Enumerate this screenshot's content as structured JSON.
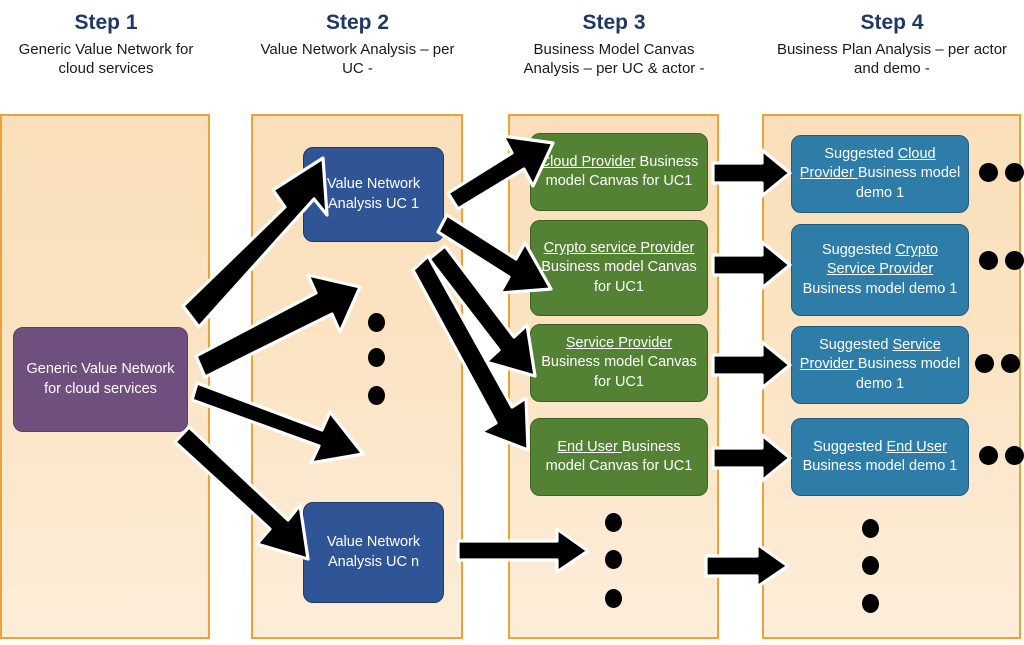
{
  "columns": [
    {
      "id": "step1",
      "title": "Step 1",
      "subtitle": "Generic Value Network for cloud services"
    },
    {
      "id": "step2",
      "title": "Step 2",
      "subtitle": "Value Network Analysis – per UC -"
    },
    {
      "id": "step3",
      "title": "Step 3",
      "subtitle": "Business Model Canvas Analysis – per UC & actor -"
    },
    {
      "id": "step4",
      "title": "Step 4",
      "subtitle": "Business Plan Analysis – per actor and demo -"
    }
  ],
  "step1": {
    "node": {
      "label": "Generic Value Network for cloud services"
    }
  },
  "step2": {
    "nodes": [
      {
        "label": "Value Network Analysis UC 1"
      },
      {
        "label": "Value Network Analysis UC n"
      }
    ],
    "ellipsis": "⋮"
  },
  "step3": {
    "nodes": [
      {
        "actor": "Cloud Provider",
        "rest": " Business model Canvas for UC1"
      },
      {
        "actor": "Crypto service Provider ",
        "rest": "Business model Canvas for UC1"
      },
      {
        "actor": "Service Provider",
        "rest": " Business model Canvas for UC1"
      },
      {
        "actor": "End User ",
        "rest": "Business model Canvas for UC1"
      }
    ],
    "ellipsis": "⋮"
  },
  "step4": {
    "nodes": [
      {
        "pre": "Suggested ",
        "actor": "Cloud Provider ",
        "rest": "Business model demo 1"
      },
      {
        "pre": "Suggested ",
        "actor": "Crypto Service Provider",
        "rest": " Business model demo 1"
      },
      {
        "pre": "Suggested ",
        "actor": "Service Provider ",
        "rest": "Business model demo 1"
      },
      {
        "pre": "Suggested ",
        "actor": "End User",
        "rest": " Business model demo 1"
      }
    ],
    "ellipsis": "⋮"
  },
  "colors": {
    "header_title": "#1F3864",
    "panel_border": "#E8A33D",
    "panel_fill": "#FADFBA",
    "purple": "#6E4F7E",
    "blue": "#2F5597",
    "green": "#548235",
    "teal": "#2E7CA8",
    "arrow": "#000000"
  }
}
